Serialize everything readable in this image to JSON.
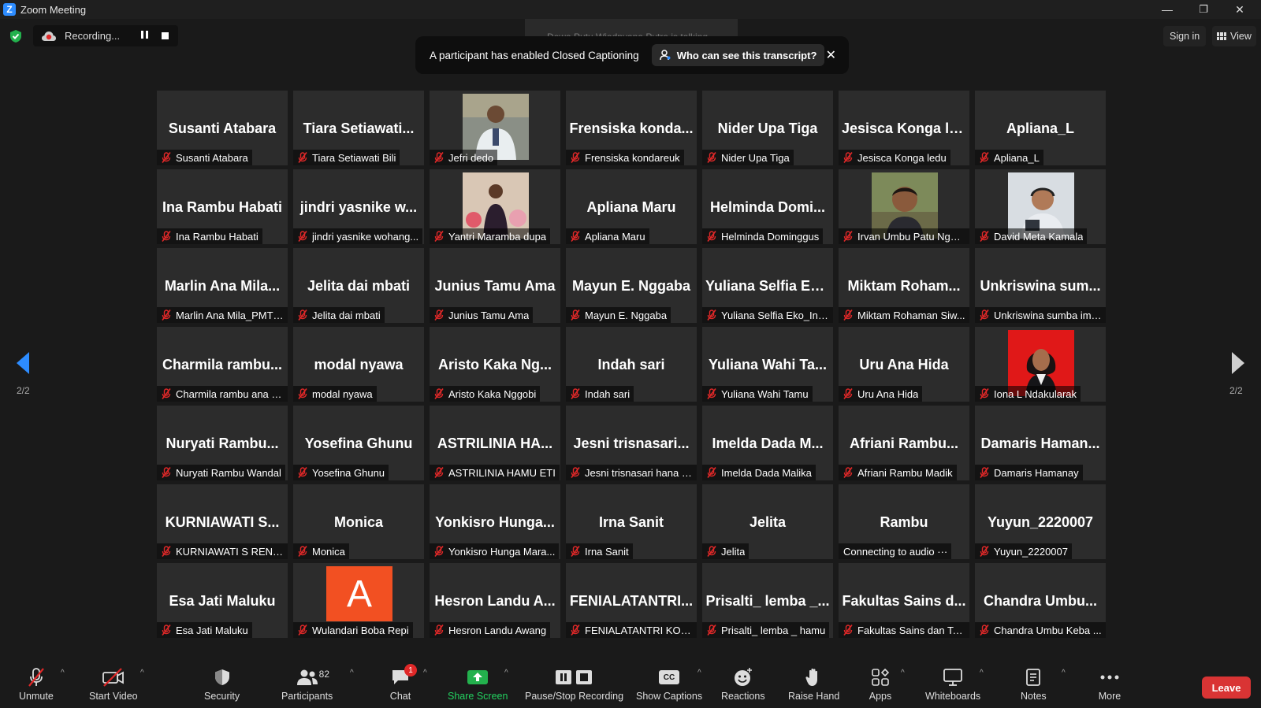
{
  "window": {
    "title": "Zoom Meeting",
    "logo_letter": "Z",
    "minimize": "—",
    "restore": "❐",
    "close": "✕"
  },
  "recording": {
    "text": "Recording..."
  },
  "talking": "Dewa Putu Wiadnyana Putra is talking...",
  "cc_banner": {
    "text": "A participant has enabled Closed Captioning",
    "who_label": "Who can see this transcript?",
    "close": "✕"
  },
  "sign_in": "Sign in",
  "view": "View",
  "pagination": {
    "left": "2/2",
    "right": "2/2"
  },
  "tiles": [
    {
      "name": "Susanti Atabara",
      "label": "Susanti Atabara"
    },
    {
      "name": "Tiara Setiawati...",
      "label": "Tiara Setiawati Bili"
    },
    {
      "photo": "man-white-coat",
      "label": "Jefri dedo"
    },
    {
      "name": "Frensiska konda...",
      "label": "Frensiska kondareuk"
    },
    {
      "name": "Nider Upa Tiga",
      "label": "Nider Upa Tiga"
    },
    {
      "name": "Jesisca Konga le...",
      "label": "Jesisca Konga ledu"
    },
    {
      "name": "Apliana_L",
      "label": "Apliana_L"
    },
    {
      "name": "Ina Rambu Habati",
      "label": "Ina Rambu Habati"
    },
    {
      "name": "jindri yasnike w...",
      "label": "jindri yasnike wohang..."
    },
    {
      "photo": "woman-flowers",
      "label": "Yantri Maramba dupa"
    },
    {
      "name": "Apliana Maru",
      "label": "Apliana Maru"
    },
    {
      "name": "Helminda Domi...",
      "label": "Helminda Dominggus"
    },
    {
      "photo": "young-man",
      "label": "Irvan Umbu Patu Ngun..."
    },
    {
      "photo": "man-headphones",
      "label": "David Meta Kamala"
    },
    {
      "name": "Marlin Ana Mila...",
      "label": "Marlin Ana Mila_PMT21"
    },
    {
      "name": "Jelita dai mbati",
      "label": "Jelita dai mbati"
    },
    {
      "name": "Junius Tamu Ama",
      "label": "Junius Tamu Ama"
    },
    {
      "name": "Mayun E. Nggaba",
      "label": "Mayun E. Nggaba"
    },
    {
      "name": "Yuliana Selfia Ek...",
      "label": "Yuliana Selfia Eko_Ind..."
    },
    {
      "name": "Miktam Roham...",
      "label": "Miktam Rohaman Siw..."
    },
    {
      "name": "Unkriswina sum...",
      "label": "Unkriswina sumba ima..."
    },
    {
      "name": "Charmila rambu...",
      "label": "Charmila rambu ana a..."
    },
    {
      "name": "modal nyawa",
      "label": "modal nyawa"
    },
    {
      "name": "Aristo Kaka Ng...",
      "label": "Aristo Kaka Nggobi"
    },
    {
      "name": "Indah sari",
      "label": "Indah sari"
    },
    {
      "name": "Yuliana Wahi Ta...",
      "label": "Yuliana Wahi Tamu"
    },
    {
      "name": "Uru Ana Hida",
      "label": "Uru Ana Hida"
    },
    {
      "photo": "woman-red",
      "label": "Iona L Ndakularak"
    },
    {
      "name": "Nuryati Rambu...",
      "label": "Nuryati Rambu Wandal"
    },
    {
      "name": "Yosefina Ghunu",
      "label": "Yosefina Ghunu"
    },
    {
      "name": "ASTRILINIA HA...",
      "label": "ASTRILINIA HAMU ETI"
    },
    {
      "name": "Jesni trisnasari...",
      "label": "Jesni trisnasari hana ni..."
    },
    {
      "name": "Imelda Dada M...",
      "label": "Imelda Dada Malika"
    },
    {
      "name": "Afriani Rambu...",
      "label": "Afriani Rambu Madik"
    },
    {
      "name": "Damaris Haman...",
      "label": "Damaris Hamanay"
    },
    {
      "name": "KURNIAWATI S...",
      "label": "KURNIAWATI S RENGG..."
    },
    {
      "name": "Monica",
      "label": "Monica"
    },
    {
      "name": "Yonkisro Hunga...",
      "label": "Yonkisro Hunga Mara..."
    },
    {
      "name": "Irna Sanit",
      "label": "Irna Sanit"
    },
    {
      "name": "Jelita",
      "label": "Jelita"
    },
    {
      "name": "Rambu",
      "label": "Connecting to audio ···",
      "no_mic": true
    },
    {
      "name": "Yuyun_2220007",
      "label": "Yuyun_2220007"
    },
    {
      "name": "Esa Jati Maluku",
      "label": "Esa Jati Maluku"
    },
    {
      "avatar": "A",
      "label": "Wulandari Boba Repi"
    },
    {
      "name": "Hesron Landu A...",
      "label": "Hesron Landu Awang"
    },
    {
      "name": "FENIALATANTRI...",
      "label": "FENIALATANTRI KOND..."
    },
    {
      "name": "Prisalti_ lemba _...",
      "label": "Prisalti_ lemba _ hamu"
    },
    {
      "name": "Fakultas Sains d...",
      "label": "Fakultas Sains dan Tek..."
    },
    {
      "name": "Chandra Umbu...",
      "label": "Chandra Umbu  Keba ..."
    }
  ],
  "toolbar": {
    "unmute": "Unmute",
    "start_video": "Start Video",
    "security": "Security",
    "participants": "Participants",
    "participants_count": "82",
    "chat": "Chat",
    "chat_badge": "1",
    "share_screen": "Share Screen",
    "pause_stop_recording": "Pause/Stop Recording",
    "show_captions": "Show Captions",
    "reactions": "Reactions",
    "raise_hand": "Raise Hand",
    "apps": "Apps",
    "whiteboards": "Whiteboards",
    "notes": "Notes",
    "more": "More",
    "leave": "Leave",
    "caret": "^",
    "cc_icon": "CC"
  },
  "colors": {
    "background": "#1a1a1a",
    "tile": "#2c2c2c",
    "share_green": "#23b14d",
    "leave_red": "#d93434",
    "muted_red": "#e02828",
    "accent_blue": "#2d8cff"
  }
}
